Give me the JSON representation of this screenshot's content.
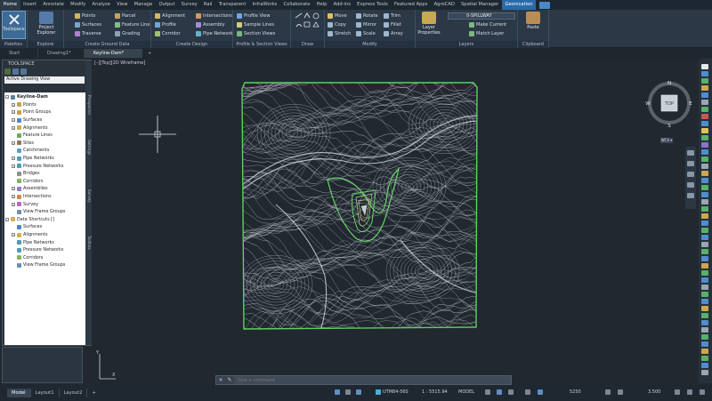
{
  "menu": {
    "tabs": [
      "Home",
      "Insert",
      "Annotate",
      "Modify",
      "Analyze",
      "View",
      "Manage",
      "Output",
      "Survey",
      "Rail",
      "Transparent",
      "InfraWorks",
      "Collaborate",
      "Help",
      "Add-ins",
      "Express Tools",
      "Featured Apps",
      "AgroCAD",
      "Spatial Manager",
      "Geonication"
    ],
    "active": "Home",
    "highlight": "Geonication"
  },
  "ribbon": {
    "toolspace": "Toolspace",
    "project_explorer": "Project Explorer",
    "points": "Points",
    "surfaces": "Surfaces",
    "traverse": "Traverse",
    "parcel": "Parcel",
    "feature_line": "Feature Line",
    "grading": "Grading",
    "alignment": "Alignment",
    "profile": "Profile",
    "corridor": "Corridor",
    "intersections": "Intersections",
    "assembly": "Assembly",
    "pipe_network": "Pipe Network",
    "profile_view": "Profile View",
    "sample_lines": "Sample Lines",
    "section_views": "Section Views",
    "move": "Move",
    "copy": "Copy",
    "stretch": "Stretch",
    "rotate": "Rotate",
    "mirror": "Mirror",
    "scale": "Scale",
    "trim": "Trim",
    "fillet": "Fillet",
    "array": "Array",
    "layer_properties": "Layer Properties",
    "layer_name": "0-SPILLWAY",
    "make_current": "Make Current",
    "match_layer": "Match Layer",
    "paste": "Paste",
    "panels": [
      "Palettes",
      "Explore",
      "Create Ground Data",
      "Create Design",
      "Profile & Section Views",
      "Draw",
      "Modify",
      "Layers",
      "Clipboard"
    ]
  },
  "doctabs": {
    "start": "Start",
    "drawing1": "Drawing1*",
    "keyline": "Keyline-Dam*"
  },
  "view_label": "[–][Top][2D Wireframe]",
  "toolspace": {
    "title": "TOOLSPACE",
    "view": "Active Drawing View",
    "root": "Keyline-Dam",
    "items": [
      "Points",
      "Point Groups",
      "Surfaces",
      "Alignments",
      "Feature Lines",
      "Sites",
      "Catchments",
      "Pipe Networks",
      "Pressure Networks",
      "Bridges",
      "Corridors",
      "Assemblies",
      "Intersections",
      "Survey",
      "View Frame Groups"
    ],
    "shortcuts_root": "Data Shortcuts []",
    "shortcut_items": [
      "Surfaces",
      "Alignments",
      "Pipe Networks",
      "Pressure Networks",
      "Corridors",
      "View Frame Groups"
    ],
    "side_tabs": [
      "Prospector",
      "Settings",
      "Survey",
      "Toolbox"
    ]
  },
  "viewcube": {
    "top": "TOP",
    "n": "N",
    "s": "S",
    "e": "E",
    "w": "W",
    "wcs": "WCS ▾"
  },
  "command": {
    "placeholder": "Type a command"
  },
  "layouts": [
    "Model",
    "Layout1",
    "Layout2"
  ],
  "status": {
    "coord": "UTM84-56S",
    "scale": "1 : 5515.94",
    "model": "MODEL",
    "lineweight": "5250",
    "zoom": "3.500"
  },
  "colors": {
    "accent": "#2b6aa9",
    "site_border": "#5fcf5f",
    "dam": "#6bd36b",
    "contour": "#b9c0c8"
  }
}
